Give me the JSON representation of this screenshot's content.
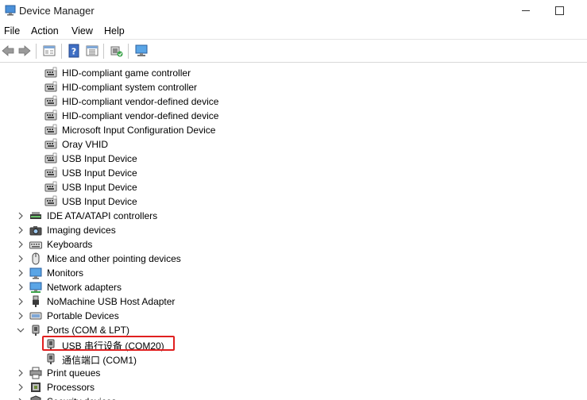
{
  "window": {
    "title": "Device Manager"
  },
  "menu": [
    "File",
    "Action",
    "View",
    "Help"
  ],
  "tree": {
    "children": [
      {
        "label": "HID-compliant game controller",
        "icon": "hid-device-icon",
        "level": 2
      },
      {
        "label": "HID-compliant system controller",
        "icon": "hid-device-icon",
        "level": 2
      },
      {
        "label": "HID-compliant vendor-defined device",
        "icon": "hid-device-icon",
        "level": 2
      },
      {
        "label": "HID-compliant vendor-defined device",
        "icon": "hid-device-icon",
        "level": 2
      },
      {
        "label": "Microsoft Input Configuration Device",
        "icon": "hid-device-icon",
        "level": 2
      },
      {
        "label": "Oray VHID",
        "icon": "hid-device-icon",
        "level": 2
      },
      {
        "label": "USB Input Device",
        "icon": "hid-device-icon",
        "level": 2
      },
      {
        "label": "USB Input Device",
        "icon": "hid-device-icon",
        "level": 2
      },
      {
        "label": "USB Input Device",
        "icon": "hid-device-icon",
        "level": 2
      },
      {
        "label": "USB Input Device",
        "icon": "hid-device-icon",
        "level": 2
      },
      {
        "label": "IDE ATA/ATAPI controllers",
        "icon": "ide-controller-icon",
        "level": 1,
        "expanded": false
      },
      {
        "label": "Imaging devices",
        "icon": "camera-icon",
        "level": 1,
        "expanded": false
      },
      {
        "label": "Keyboards",
        "icon": "keyboard-icon",
        "level": 1,
        "expanded": false
      },
      {
        "label": "Mice and other pointing devices",
        "icon": "mouse-icon",
        "level": 1,
        "expanded": false
      },
      {
        "label": "Monitors",
        "icon": "monitor-icon",
        "level": 1,
        "expanded": false
      },
      {
        "label": "Network adapters",
        "icon": "network-adapter-icon",
        "level": 1,
        "expanded": false
      },
      {
        "label": "NoMachine USB Host Adapter",
        "icon": "usb-plug-icon",
        "level": 1,
        "expanded": false
      },
      {
        "label": "Portable Devices",
        "icon": "portable-device-icon",
        "level": 1,
        "expanded": false
      },
      {
        "label": "Ports (COM & LPT)",
        "icon": "port-icon",
        "level": 1,
        "expanded": true
      },
      {
        "label": "USB 串行设备 (COM20)",
        "icon": "port-icon",
        "level": 2,
        "highlighted": true
      },
      {
        "label": "通信端口 (COM1)",
        "icon": "port-icon",
        "level": 2
      },
      {
        "label": "Print queues",
        "icon": "printer-icon",
        "level": 1,
        "expanded": false
      },
      {
        "label": "Processors",
        "icon": "processor-icon",
        "level": 1,
        "expanded": false
      },
      {
        "label": "Security devices",
        "icon": "security-device-icon",
        "level": 1,
        "expanded": false
      }
    ]
  },
  "colors": {
    "highlight_border": "#e02020"
  }
}
